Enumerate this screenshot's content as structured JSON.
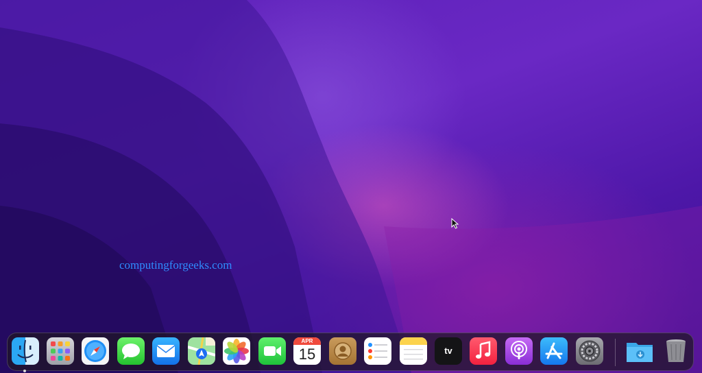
{
  "desktop": {
    "watermark": "computingforgeeks.com"
  },
  "dock": {
    "apps": [
      {
        "name": "Finder",
        "icon": "finder-icon",
        "running": true
      },
      {
        "name": "Launchpad",
        "icon": "launchpad-icon"
      },
      {
        "name": "Safari",
        "icon": "safari-icon"
      },
      {
        "name": "Messages",
        "icon": "messages-icon"
      },
      {
        "name": "Mail",
        "icon": "mail-icon"
      },
      {
        "name": "Maps",
        "icon": "maps-icon"
      },
      {
        "name": "Photos",
        "icon": "photos-icon"
      },
      {
        "name": "FaceTime",
        "icon": "facetime-icon"
      },
      {
        "name": "Calendar",
        "icon": "calendar-icon",
        "month": "APR",
        "day": "15"
      },
      {
        "name": "Contacts",
        "icon": "contacts-icon"
      },
      {
        "name": "Reminders",
        "icon": "reminders-icon"
      },
      {
        "name": "Notes",
        "icon": "notes-icon"
      },
      {
        "name": "TV",
        "icon": "apple-tv-icon",
        "label": "tv"
      },
      {
        "name": "Music",
        "icon": "music-icon"
      },
      {
        "name": "Podcasts",
        "icon": "podcasts-icon"
      },
      {
        "name": "App Store",
        "icon": "app-store-icon"
      },
      {
        "name": "System Preferences",
        "icon": "system-preferences-icon"
      }
    ],
    "stacks": [
      {
        "name": "Downloads",
        "icon": "downloads-folder-icon"
      },
      {
        "name": "Trash",
        "icon": "trash-icon"
      }
    ]
  },
  "colors": {
    "wallpaper_base": "#3a1290",
    "watermark": "#2f8cff",
    "dock_bg": "#1e1624"
  }
}
